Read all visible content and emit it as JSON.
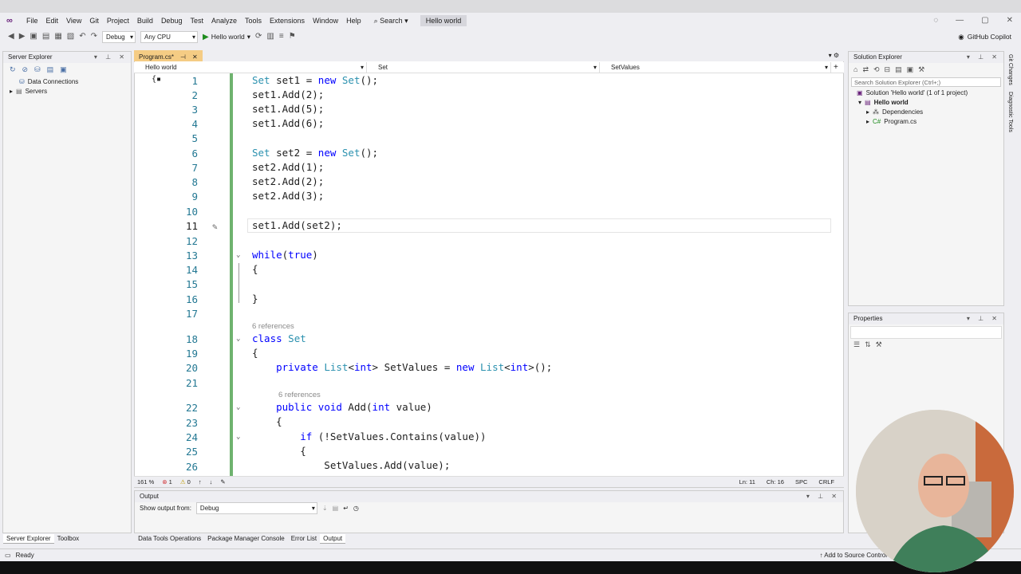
{
  "menubar": {
    "items": [
      "File",
      "Edit",
      "View",
      "Git",
      "Project",
      "Build",
      "Debug",
      "Test",
      "Analyze",
      "Tools",
      "Extensions",
      "Window",
      "Help"
    ],
    "search_label": "Search",
    "solution_name": "Hello world"
  },
  "toolbar": {
    "configuration": "Debug",
    "platform": "Any CPU",
    "run_label": "Hello world",
    "copilot_label": "GitHub Copilot"
  },
  "server_explorer": {
    "title": "Server Explorer",
    "items": [
      "Data Connections",
      "Servers"
    ]
  },
  "editor": {
    "tab_label": "Program.cs*",
    "nav_project": "Hello world",
    "nav_type": "Set",
    "nav_member": "SetValues",
    "zoom": "161 %",
    "errors": "1",
    "warnings": "0",
    "line": "Ln: 11",
    "col": "Ch: 16",
    "spaces": "SPC",
    "eol": "CRLF",
    "line_numbers": [
      "1",
      "2",
      "3",
      "4",
      "5",
      "6",
      "7",
      "8",
      "9",
      "10",
      "11",
      "12",
      "13",
      "14",
      "15",
      "16",
      "17",
      "18",
      "19",
      "20",
      "21",
      "22",
      "23",
      "24",
      "25",
      "26"
    ],
    "refs_label": "6 references",
    "refs_label_2": "6 references"
  },
  "solution_explorer": {
    "title": "Solution Explorer",
    "search_placeholder": "Search Solution Explorer (Ctrl+;)",
    "solution_line": "Solution 'Hello world' (1 of 1 project)",
    "project": "Hello world",
    "dependencies": "Dependencies",
    "program": "Program.cs"
  },
  "properties": {
    "title": "Properties"
  },
  "output": {
    "title": "Output",
    "show_from_label": "Show output from:",
    "source": "Debug"
  },
  "bottom_tabs_left": [
    "Server Explorer",
    "Toolbox"
  ],
  "bottom_tabs_center": [
    "Data Tools Operations",
    "Package Manager Console",
    "Error List",
    "Output"
  ],
  "status": {
    "ready": "Ready",
    "add_source": "Add to Source Control"
  },
  "right_rail": [
    "Git Changes",
    "Diagnostic Tools"
  ]
}
